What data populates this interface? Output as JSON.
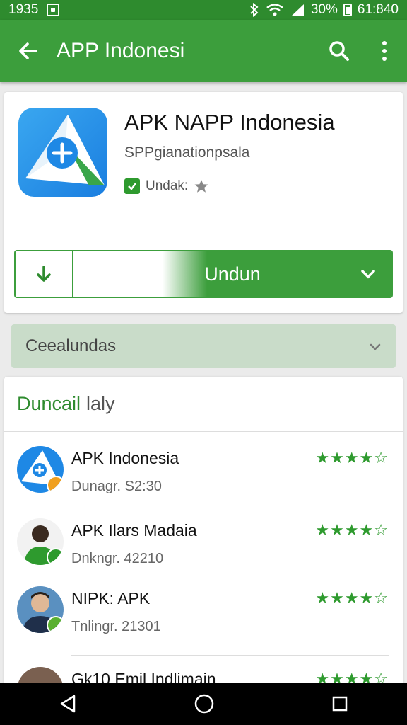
{
  "status_bar": {
    "time_left": "1935",
    "battery": "30%",
    "clock": "61:840"
  },
  "app_bar": {
    "title": "APP Indonesi"
  },
  "app": {
    "title": "APK NAPP Indonesia",
    "developer": "SPPgianationpsala",
    "badge_label": "Undak:",
    "install_label": "Undun"
  },
  "section": {
    "label": "Ceealundas"
  },
  "list": {
    "header_accent": "Duncail",
    "header_rest": "laly",
    "items": [
      {
        "name": "APK Indonesia",
        "sub": "Dunagr. S2:30",
        "stars_full": "★★★★",
        "stars_empty": "☆"
      },
      {
        "name": "APK Ilars Madaia",
        "sub": "Dnkngr. 42210",
        "stars_full": "★★★★",
        "stars_empty": "☆"
      },
      {
        "name": "NIPK: APK",
        "sub": "Tnlingr. 21301",
        "stars_full": "★★★★",
        "stars_empty": "☆"
      },
      {
        "name": "Gk10 Emil Indlimain",
        "sub": "",
        "stars_full": "★★★★",
        "stars_empty": "☆"
      }
    ]
  },
  "colors": {
    "primary": "#3c9e3c",
    "status_bar": "#2e8b2e",
    "section_bg": "#c9dcc9"
  },
  "icons": [
    "back-arrow-icon",
    "search-icon",
    "more-vert-icon",
    "download-icon",
    "chevron-down-icon",
    "check-icon",
    "star-icon",
    "back-nav-icon",
    "home-nav-icon",
    "recents-nav-icon"
  ]
}
